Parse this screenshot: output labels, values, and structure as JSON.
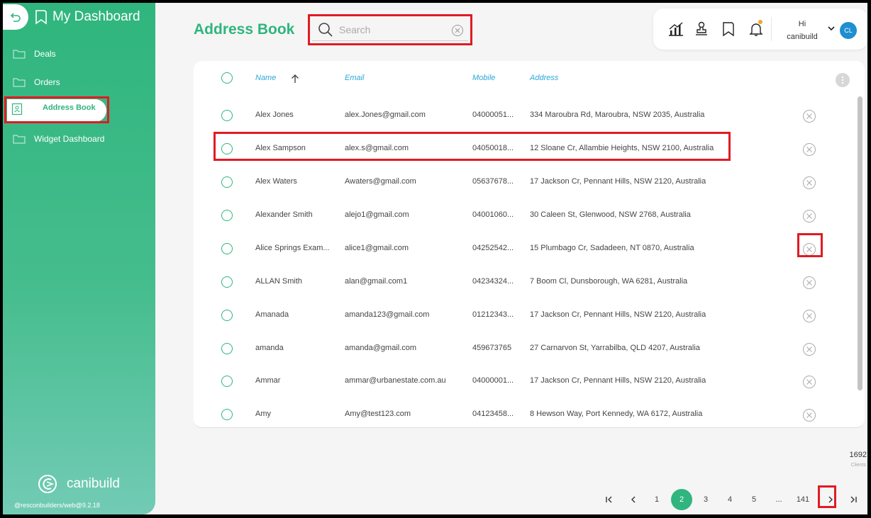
{
  "sidebar": {
    "title": "My Dashboard",
    "items": [
      {
        "label": "Deals"
      },
      {
        "label": "Orders"
      },
      {
        "label": "Address Book",
        "active": true
      },
      {
        "label": "Widget Dashboard"
      }
    ],
    "logo_text": "canibuild",
    "version": "@resconbuilders/web@9.2.18"
  },
  "header": {
    "title": "Address Book",
    "search_placeholder": "Search",
    "greeting": "Hi",
    "username": "canibuild",
    "avatar_initials": "CL"
  },
  "table": {
    "columns": [
      "Name",
      "Email",
      "Mobile",
      "Address"
    ],
    "sort_column": "Name",
    "rows": [
      {
        "name": "Alex Jones",
        "email": "alex.Jones@gmail.com",
        "mobile": "04000051...",
        "address": "334 Maroubra Rd, Maroubra, NSW 2035, Australia"
      },
      {
        "name": "Alex Sampson",
        "email": "alex.s@gmail.com",
        "mobile": "04050018...",
        "address": "12 Sloane Cr, Allambie Heights, NSW 2100, Australia"
      },
      {
        "name": "Alex Waters",
        "email": "Awaters@gmail.com",
        "mobile": "05637678...",
        "address": "17 Jackson Cr, Pennant Hills, NSW 2120, Australia"
      },
      {
        "name": "Alexander Smith",
        "email": "alejo1@gmail.com",
        "mobile": "04001060...",
        "address": "30 Caleen St, Glenwood, NSW 2768, Australia"
      },
      {
        "name": "Alice Springs Exam...",
        "email": "alice1@gmail.com",
        "mobile": "04252542...",
        "address": "15 Plumbago Cr, Sadadeen, NT 0870, Australia"
      },
      {
        "name": "ALLAN Smith",
        "email": "alan@gmail.com1",
        "mobile": "04234324...",
        "address": "7 Boom Cl, Dunsborough, WA 6281, Australia"
      },
      {
        "name": "Amanada",
        "email": "amanda123@gmail.com",
        "mobile": "01212343...",
        "address": "17 Jackson Cr, Pennant Hills, NSW 2120, Australia"
      },
      {
        "name": "amanda",
        "email": "amanda@gmail.com",
        "mobile": "459673765",
        "address": "27 Carnarvon St, Yarrabilba, QLD 4207, Australia"
      },
      {
        "name": "Ammar",
        "email": "ammar@urbanestate.com.au",
        "mobile": "04000001...",
        "address": "17 Jackson Cr, Pennant Hills, NSW 2120, Australia"
      },
      {
        "name": "Amy",
        "email": "Amy@test123.com",
        "mobile": "04123458...",
        "address": "8 Hewson Way, Port Kennedy, WA 6172, Australia"
      }
    ]
  },
  "footer": {
    "count": "1692",
    "count_label": "Clients",
    "pages": [
      "1",
      "2",
      "3",
      "4",
      "5",
      "...",
      "141"
    ],
    "current_page": "2"
  },
  "colors": {
    "brand": "#2fb57d",
    "header_link": "#2aa8d8",
    "highlight": "#e01b24"
  }
}
